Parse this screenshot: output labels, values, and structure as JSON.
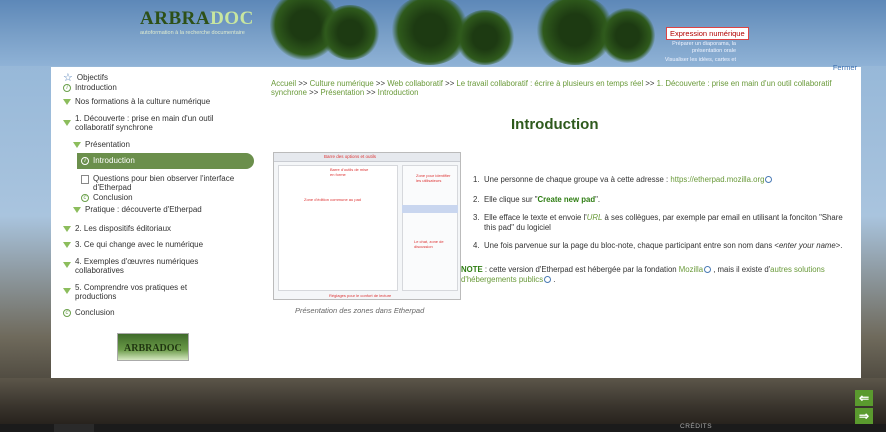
{
  "header": {
    "logo_main": "ARBRA",
    "logo_accent": "DOC",
    "logo_tagline": "autoformation à la recherche documentaire",
    "top_link": "Expression numérique",
    "sub_lines": [
      "Préparer un diaporama, la",
      "présentation orale",
      "Visualiser les idées, cartes et"
    ]
  },
  "close_label": "Fermer",
  "sidebar": {
    "objectives": "Objectifs",
    "introduction": "Introduction",
    "formations": "Nos formations à la culture numérique",
    "s1": "1. Découverte : prise en main d'un outil collaboratif synchrone",
    "presentation": "Présentation",
    "intro_active": "Introduction",
    "questions": "Questions pour bien observer l'interface d'Etherpad",
    "conclusion_sub": "Conclusion",
    "pratique": "Pratique : découverte d'Etherpad",
    "s2": "2. Les dispositifs éditoriaux",
    "s3": "3. Ce qui change avec le numérique",
    "s4": "4. Exemples d'œuvres numériques collaboratives",
    "s5": "5. Comprendre vos pratiques et productions",
    "conclusion": "Conclusion",
    "logo_text": "ARBRADOC"
  },
  "breadcrumb": {
    "items": [
      "Accueil",
      "Culture numérique",
      "Web collaboratif",
      "Le travail collaboratif : écrire à plusieurs en temps réel",
      "1. Découverte : prise en main d'un outil collaboratif synchrone",
      "Présentation",
      "Introduction"
    ],
    "separator": ">>"
  },
  "page_title": "Introduction",
  "figure": {
    "caption": "Présentation des zones dans Etherpad",
    "toolbar_note": "Barre des options et outils",
    "zone1": "Barre d'outils de mise en forme",
    "zone2": "Zone d'édition commune au pad",
    "zone3": "Zone pour identifier les utilisateurs",
    "zone4": "Le chat, zone de discussion",
    "zone5": "Réglages pour le confort de lecture"
  },
  "steps": [
    {
      "num": "1.",
      "pre": "Une personne de chaque groupe va à cette adresse : ",
      "link": "https://etherpad.mozilla.org",
      "post": ""
    },
    {
      "num": "2.",
      "pre": "Elle clique sur \"",
      "strong": "Create new pad",
      "post": "\"."
    },
    {
      "num": "3.",
      "pre": "Elle efface le texte et envoie l'",
      "link": "URL",
      "post": " à ses collègues, par exemple par email en utilisant la fonciton \"Share this pad\" du logiciel"
    },
    {
      "num": "4.",
      "pre": "Une fois parvenue sur la page du bloc-note, chaque participant entre son nom dans <",
      "em": "enter your name",
      "post": ">."
    }
  ],
  "note": {
    "label": "NOTE",
    "pre": " : cette version d'Etherpad est hébergée par la fondation ",
    "link1": "Mozilla",
    "mid": " , mais il existe d'",
    "link2": "autres solutions d'hébergements publics",
    "post": " ."
  },
  "footer": {
    "credits": "CRÉDITS",
    "prev_icon": "⇐",
    "next_icon": "⇒"
  }
}
